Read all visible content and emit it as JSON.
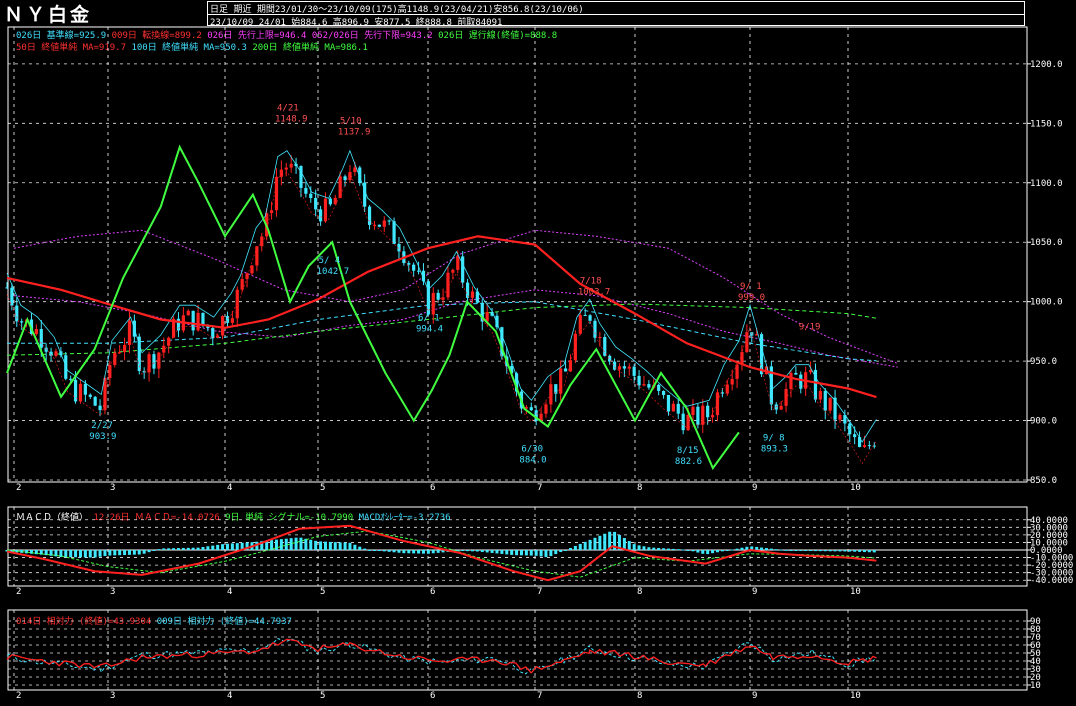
{
  "title": "ＮＹ白金",
  "header": {
    "mode": "日足",
    "contract": "期近",
    "period": "期間23/01/30～23/10/09(175)高1148.9(23/04/21)安856.8(23/10/06)",
    "last_bar": "23/10/09 24/01 始884.6 高896.9 安877.5 終888.8 前取84091"
  },
  "legends": {
    "main1": [
      {
        "text": "026日 基準線=925.9",
        "color": "#40e0ff"
      },
      {
        "text": "009日 転換線=899.2",
        "color": "#ff3030"
      },
      {
        "text": "026日 先行上限=946.4",
        "color": "#ff40ff"
      },
      {
        "text": "052/026日 先行下限=943.2",
        "color": "#ff40ff"
      },
      {
        "text": "026日 遅行線(終値)=888.8",
        "color": "#40ff40"
      }
    ],
    "main2": [
      {
        "text": "50日 終値単純 MA=919.7",
        "color": "#ff3030"
      },
      {
        "text": "100日 終値単純 MA=950.3",
        "color": "#40e0ff"
      },
      {
        "text": "200日 終値単純 MA=986.1",
        "color": "#40ff40"
      }
    ],
    "macd": [
      {
        "text": "ＭＡＣＤ（終値）",
        "color": "#ffffff"
      },
      {
        "text": "12-26日 ＭＡＣＤ=-14.0726",
        "color": "#ff3030"
      },
      {
        "text": "9日 単純 シグナル=-10.7990",
        "color": "#40ff40"
      },
      {
        "text": "MACDｵｼﾚｰﾀｰ=-3.2736",
        "color": "#40e0ff"
      }
    ],
    "rsi": [
      {
        "text": "014日 相対力 (終値)=43.9304",
        "color": "#ff3030"
      },
      {
        "text": "009日 相対力 (終値)=44.7937",
        "color": "#40e0ff"
      }
    ]
  },
  "colors": {
    "up": "#ff2020",
    "down": "#40e8ff",
    "ma50": "#ff2020",
    "ma100": "#40e0ff",
    "ma200": "#40ff40",
    "lag": "#40ff40",
    "kumo": "#e040ff",
    "grid": "#ffffff"
  },
  "chart_data": [
    {
      "type": "candlestick",
      "panel": "price",
      "x_months": [
        "2",
        "3",
        "4",
        "5",
        "6",
        "7",
        "8",
        "9",
        "10"
      ],
      "y_ticks": [
        850,
        900,
        950,
        1000,
        1050,
        1100,
        1150,
        1200
      ],
      "y_tick_labels": [
        "850.0",
        "900.0",
        "950.0",
        "1000.0",
        "1050.0",
        "1100.0",
        "1150.0",
        "1200.0"
      ],
      "ylim": [
        850,
        1210
      ],
      "annotations": [
        {
          "date": "2/27",
          "value": 903.9,
          "label": "2/27",
          "sub": "903.9"
        },
        {
          "date": "4/21",
          "value": 1148.9,
          "label": "4/21",
          "sub": "1148.9"
        },
        {
          "date": "5/10",
          "value": 1137.9,
          "label": "5/10",
          "sub": "1137.9"
        },
        {
          "date": "5/4",
          "value": 1042.7,
          "label": "5/ 4",
          "sub": "1042.7"
        },
        {
          "date": "6/1",
          "value": 994.4,
          "label": "6/ 1",
          "sub": "994.4"
        },
        {
          "date": "6/30",
          "value": 884.0,
          "label": "6/30",
          "sub": "884.0"
        },
        {
          "date": "7/18",
          "value": 1003.7,
          "label": "7/18",
          "sub": "1003.7"
        },
        {
          "date": "8/15",
          "value": 882.6,
          "label": "8/15",
          "sub": "882.6"
        },
        {
          "date": "9/1",
          "value": 999.0,
          "label": "9/ 1",
          "sub": "999.0"
        },
        {
          "date": "9/8",
          "value": 893.3,
          "label": "9/ 8",
          "sub": "893.3"
        },
        {
          "date": "9/19",
          "value": 965.0,
          "label": "9/19",
          "sub": ""
        }
      ],
      "close_path": [
        [
          "1/30",
          1012
        ],
        [
          "2/3",
          985
        ],
        [
          "2/8",
          975
        ],
        [
          "2/13",
          958
        ],
        [
          "2/17",
          930
        ],
        [
          "2/22",
          920
        ],
        [
          "2/27",
          910
        ],
        [
          "3/2",
          955
        ],
        [
          "3/7",
          975
        ],
        [
          "3/10",
          945
        ],
        [
          "3/15",
          960
        ],
        [
          "3/20",
          985
        ],
        [
          "3/24",
          985
        ],
        [
          "3/29",
          975
        ],
        [
          "4/3",
          995
        ],
        [
          "4/6",
          1010
        ],
        [
          "4/11",
          1050
        ],
        [
          "4/14",
          1060
        ],
        [
          "4/18",
          1110
        ],
        [
          "4/21",
          1115
        ],
        [
          "4/26",
          1095
        ],
        [
          "4/29",
          1080
        ],
        [
          "5/4",
          1075
        ],
        [
          "5/8",
          1100
        ],
        [
          "5/10",
          1115
        ],
        [
          "5/15",
          1075
        ],
        [
          "5/19",
          1065
        ],
        [
          "5/24",
          1050
        ],
        [
          "5/29",
          1020
        ],
        [
          "6/1",
          998
        ],
        [
          "6/5",
          1010
        ],
        [
          "6/9",
          1030
        ],
        [
          "6/14",
          1000
        ],
        [
          "6/19",
          980
        ],
        [
          "6/23",
          950
        ],
        [
          "6/27",
          915
        ],
        [
          "6/30",
          905
        ],
        [
          "7/5",
          925
        ],
        [
          "7/10",
          935
        ],
        [
          "7/14",
          975
        ],
        [
          "7/18",
          990
        ],
        [
          "7/21",
          970
        ],
        [
          "7/26",
          950
        ],
        [
          "7/31",
          940
        ],
        [
          "8/4",
          930
        ],
        [
          "8/9",
          915
        ],
        [
          "8/15",
          900
        ],
        [
          "8/21",
          905
        ],
        [
          "8/25",
          935
        ],
        [
          "8/29",
          955
        ],
        [
          "9/1",
          985
        ],
        [
          "9/5",
          945
        ],
        [
          "9/8",
          915
        ],
        [
          "9/12",
          925
        ],
        [
          "9/15",
          935
        ],
        [
          "9/19",
          935
        ],
        [
          "9/22",
          920
        ],
        [
          "9/27",
          905
        ],
        [
          "10/2",
          885
        ],
        [
          "10/5",
          870
        ],
        [
          "10/9",
          889
        ]
      ],
      "ma50": [
        [
          "1/30",
          1020
        ],
        [
          "2/15",
          1010
        ],
        [
          "3/1",
          998
        ],
        [
          "3/15",
          985
        ],
        [
          "4/1",
          978
        ],
        [
          "4/15",
          985
        ],
        [
          "5/1",
          1002
        ],
        [
          "5/15",
          1025
        ],
        [
          "6/1",
          1045
        ],
        [
          "6/15",
          1055
        ],
        [
          "7/1",
          1048
        ],
        [
          "7/15",
          1015
        ],
        [
          "8/1",
          990
        ],
        [
          "8/15",
          965
        ],
        [
          "9/1",
          945
        ],
        [
          "9/15",
          935
        ],
        [
          "10/1",
          927
        ],
        [
          "10/9",
          919.7
        ]
      ],
      "ma100": [
        [
          "1/30",
          965
        ],
        [
          "3/1",
          965
        ],
        [
          "4/1",
          970
        ],
        [
          "5/1",
          985
        ],
        [
          "6/1",
          997
        ],
        [
          "7/1",
          1000
        ],
        [
          "8/1",
          985
        ],
        [
          "9/1",
          965
        ],
        [
          "10/1",
          952
        ],
        [
          "10/9",
          950.3
        ]
      ],
      "ma200": [
        [
          "1/30",
          955
        ],
        [
          "3/1",
          957
        ],
        [
          "4/1",
          965
        ],
        [
          "5/1",
          975
        ],
        [
          "6/1",
          985
        ],
        [
          "7/1",
          995
        ],
        [
          "8/1",
          998
        ],
        [
          "9/1",
          995
        ],
        [
          "10/1",
          990
        ],
        [
          "10/9",
          986.1
        ]
      ],
      "kumo_upper": [
        [
          "2/1",
          1045
        ],
        [
          "2/20",
          1055
        ],
        [
          "3/10",
          1060
        ],
        [
          "3/30",
          1035
        ],
        [
          "4/20",
          1010
        ],
        [
          "5/10",
          1000
        ],
        [
          "5/25",
          1010
        ],
        [
          "6/10",
          1040
        ],
        [
          "7/1",
          1060
        ],
        [
          "7/20",
          1055
        ],
        [
          "8/10",
          1045
        ],
        [
          "8/25",
          1020
        ],
        [
          "9/10",
          990
        ],
        [
          "9/25",
          970
        ],
        [
          "10/15",
          948
        ],
        [
          "11/1",
          930
        ],
        [
          "11/10",
          918
        ]
      ],
      "kumo_lower": [
        [
          "2/1",
          1005
        ],
        [
          "2/20",
          1000
        ],
        [
          "3/10",
          990
        ],
        [
          "3/30",
          975
        ],
        [
          "4/20",
          970
        ],
        [
          "5/10",
          980
        ],
        [
          "5/25",
          985
        ],
        [
          "6/10",
          1000
        ],
        [
          "7/1",
          1010
        ],
        [
          "7/20",
          1005
        ],
        [
          "8/10",
          990
        ],
        [
          "8/25",
          975
        ],
        [
          "9/10",
          965
        ],
        [
          "9/25",
          955
        ],
        [
          "10/15",
          945
        ],
        [
          "11/1",
          935
        ],
        [
          "11/10",
          908
        ]
      ],
      "lagging_span": [
        [
          "1/30",
          940
        ],
        [
          "2/5",
          985
        ],
        [
          "2/15",
          920
        ],
        [
          "2/25",
          960
        ],
        [
          "3/5",
          1020
        ],
        [
          "3/15",
          1080
        ],
        [
          "3/20",
          1130
        ],
        [
          "3/25",
          1100
        ],
        [
          "4/1",
          1055
        ],
        [
          "4/10",
          1090
        ],
        [
          "4/15",
          1060
        ],
        [
          "4/22",
          1000
        ],
        [
          "4/28",
          1030
        ],
        [
          "5/5",
          1050
        ],
        [
          "5/10",
          1000
        ],
        [
          "5/20",
          940
        ],
        [
          "5/28",
          900
        ],
        [
          "6/2",
          925
        ],
        [
          "6/7",
          955
        ],
        [
          "6/12",
          1000
        ],
        [
          "6/20",
          975
        ],
        [
          "6/28",
          910
        ],
        [
          "7/5",
          895
        ],
        [
          "7/12",
          930
        ],
        [
          "7/20",
          960
        ],
        [
          "7/25",
          935
        ],
        [
          "8/1",
          900
        ],
        [
          "8/8",
          940
        ],
        [
          "8/15",
          910
        ],
        [
          "8/22",
          860
        ],
        [
          "8/29",
          890
        ]
      ]
    },
    {
      "type": "line",
      "panel": "macd",
      "y_ticks": [
        40,
        30,
        20,
        10,
        0,
        -10,
        -20,
        -30,
        -40
      ],
      "y_tick_labels": [
        "40.0000",
        "30.0000",
        "20.0000",
        "10.0000",
        "0.0000",
        "-10.0000",
        "-20.0000",
        "-30.0000",
        "-40.0000"
      ],
      "ylim": [
        -45,
        45
      ],
      "macd": [
        [
          "1/30",
          -2
        ],
        [
          "2/10",
          -12
        ],
        [
          "2/25",
          -28
        ],
        [
          "3/10",
          -33
        ],
        [
          "3/25",
          -18
        ],
        [
          "4/10",
          5
        ],
        [
          "4/25",
          28
        ],
        [
          "5/10",
          32
        ],
        [
          "5/25",
          12
        ],
        [
          "6/10",
          -4
        ],
        [
          "6/25",
          -28
        ],
        [
          "7/5",
          -40
        ],
        [
          "7/15",
          -28
        ],
        [
          "7/25",
          5
        ],
        [
          "8/5",
          -8
        ],
        [
          "8/20",
          -18
        ],
        [
          "9/1",
          0
        ],
        [
          "9/10",
          -5
        ],
        [
          "9/20",
          -8
        ],
        [
          "10/1",
          -10
        ],
        [
          "10/9",
          -14.07
        ]
      ],
      "signal": [
        [
          "1/30",
          0
        ],
        [
          "2/15",
          -8
        ],
        [
          "3/1",
          -22
        ],
        [
          "3/15",
          -30
        ],
        [
          "4/1",
          -15
        ],
        [
          "4/15",
          0
        ],
        [
          "5/1",
          18
        ],
        [
          "5/15",
          25
        ],
        [
          "6/1",
          10
        ],
        [
          "6/15",
          -10
        ],
        [
          "7/1",
          -28
        ],
        [
          "7/15",
          -36
        ],
        [
          "8/1",
          -10
        ],
        [
          "8/15",
          -15
        ],
        [
          "9/1",
          -5
        ],
        [
          "9/15",
          -6
        ],
        [
          "10/1",
          -8
        ],
        [
          "10/9",
          -10.8
        ]
      ]
    },
    {
      "type": "line",
      "panel": "rsi",
      "y_ticks": [
        90,
        80,
        70,
        60,
        50,
        40,
        30,
        20,
        10
      ],
      "y_tick_labels": [
        "90",
        "80",
        "70",
        "60",
        "50",
        "40",
        "30",
        "20",
        "10"
      ],
      "ylim": [
        5,
        95
      ],
      "rsi14": [
        [
          "1/30",
          45
        ],
        [
          "2/10",
          40
        ],
        [
          "2/27",
          32
        ],
        [
          "3/10",
          45
        ],
        [
          "3/25",
          48
        ],
        [
          "4/10",
          52
        ],
        [
          "4/21",
          65
        ],
        [
          "5/1",
          55
        ],
        [
          "5/10",
          60
        ],
        [
          "5/25",
          45
        ],
        [
          "6/5",
          40
        ],
        [
          "6/20",
          42
        ],
        [
          "6/30",
          28
        ],
        [
          "7/10",
          40
        ],
        [
          "7/18",
          52
        ],
        [
          "7/30",
          48
        ],
        [
          "8/10",
          38
        ],
        [
          "8/20",
          35
        ],
        [
          "9/1",
          60
        ],
        [
          "9/8",
          45
        ],
        [
          "9/20",
          48
        ],
        [
          "10/1",
          38
        ],
        [
          "10/9",
          43.93
        ]
      ],
      "rsi9": [
        [
          "1/30",
          46
        ],
        [
          "2/10",
          38
        ],
        [
          "2/27",
          30
        ],
        [
          "3/10",
          47
        ],
        [
          "3/25",
          50
        ],
        [
          "4/10",
          54
        ],
        [
          "4/21",
          68
        ],
        [
          "5/1",
          52
        ],
        [
          "5/10",
          62
        ],
        [
          "5/25",
          43
        ],
        [
          "6/5",
          38
        ],
        [
          "6/20",
          44
        ],
        [
          "6/30",
          25
        ],
        [
          "7/10",
          42
        ],
        [
          "7/18",
          55
        ],
        [
          "7/30",
          46
        ],
        [
          "8/10",
          36
        ],
        [
          "8/20",
          33
        ],
        [
          "9/1",
          64
        ],
        [
          "9/8",
          43
        ],
        [
          "9/20",
          50
        ],
        [
          "10/1",
          36
        ],
        [
          "10/9",
          44.79
        ]
      ]
    }
  ]
}
